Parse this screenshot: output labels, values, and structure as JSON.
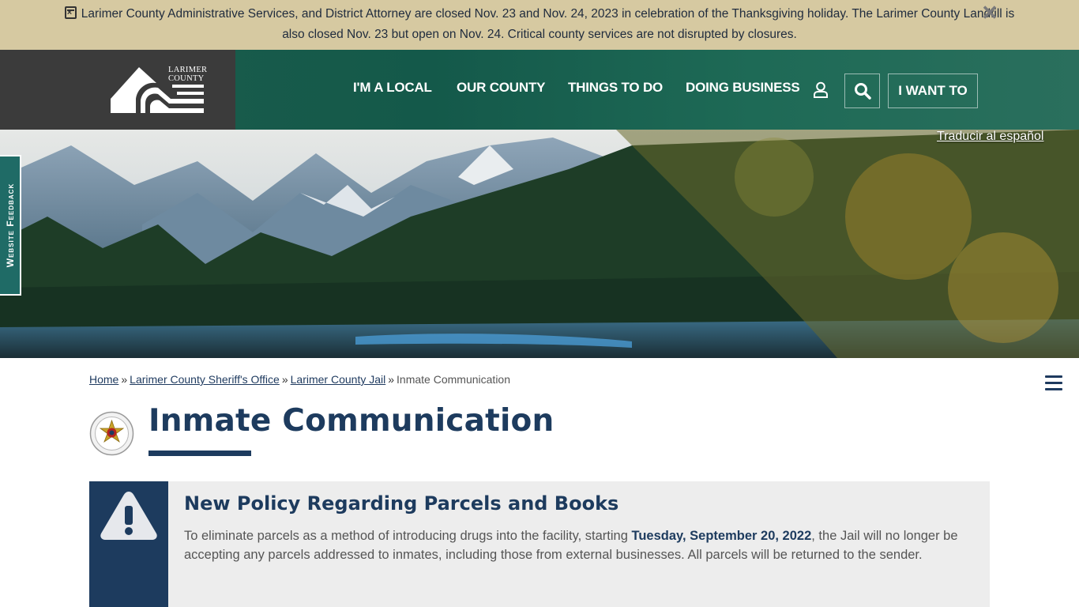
{
  "alert": {
    "line1": "Larimer County Administrative Services, and District Attorney are closed Nov. 23 and Nov. 24, 2023 in celebration of the Thanksgiving holiday. The Larimer County Landfill is",
    "line2": "also closed Nov. 23 but open on Nov. 24. Critical county services are not disrupted by closures.",
    "icon": "calendar-x-icon",
    "close_icon": "close-icon"
  },
  "header": {
    "logo_line1": "LARIMER",
    "logo_line2": "COUNTY",
    "nav": [
      "I'M A LOCAL",
      "OUR COUNTY",
      "THINGS TO DO",
      "DOING BUSINESS"
    ],
    "user_icon": "user-icon",
    "search_icon": "search-icon",
    "want_label": "I WANT TO"
  },
  "hero": {
    "translate_label": "Traducir al español"
  },
  "feedback": {
    "label": "Website Feedback"
  },
  "breadcrumb": {
    "home": "Home",
    "sheriff": "Larimer County Sheriff's Office",
    "jail": "Larimer County Jail",
    "current": "Inmate Communication",
    "separator": "»"
  },
  "page": {
    "title": "Inmate Communication",
    "badge_icon": "sheriff-badge-icon",
    "menu_icon": "hamburger-menu-icon"
  },
  "callout": {
    "icon": "warning-icon",
    "heading": "New Policy Regarding Parcels and Books",
    "text_before": "To eliminate parcels as a method of introducing drugs into the facility, starting ",
    "text_bold": "Tuesday, September 20, 2022",
    "text_after": ", the Jail will no longer be accepting any parcels addressed to inmates, including those from external businesses. All parcels will be returned to the sender."
  },
  "colors": {
    "alert_bg": "#d6c9a1",
    "header_green": "#1c5d4c",
    "logo_bg": "#3b3b3b",
    "navy": "#1d3b5e",
    "feedback_teal": "#1f6b66"
  }
}
